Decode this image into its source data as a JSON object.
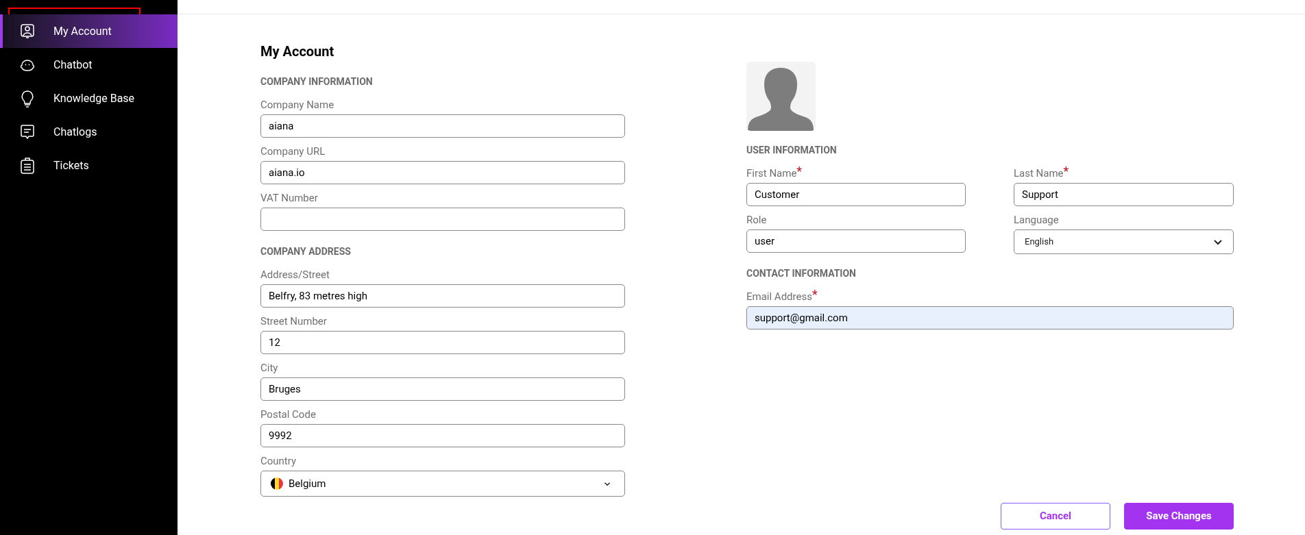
{
  "sidebar": {
    "items": [
      {
        "label": "My Account",
        "selected": true,
        "highlighted": true
      },
      {
        "label": "Chatbot",
        "selected": false,
        "highlighted": false
      },
      {
        "label": "Knowledge Base",
        "selected": false,
        "highlighted": false
      },
      {
        "label": "Chatlogs",
        "selected": false,
        "highlighted": false
      },
      {
        "label": "Tickets",
        "selected": false,
        "highlighted": false
      }
    ]
  },
  "page_title": "My Account",
  "left_sections": [
    {
      "heading": "COMPANY INFORMATION",
      "fields": [
        {
          "kind": "text",
          "label": "Company Name",
          "value": "aiana"
        },
        {
          "kind": "text",
          "label": "Company URL",
          "value": "aiana.io"
        },
        {
          "kind": "text",
          "label": "VAT Number"
        }
      ]
    },
    {
      "heading": "COMPANY ADDRESS",
      "fields": [
        {
          "kind": "text",
          "label": "Address/Street",
          "value": "Belfry, 83 metres high"
        },
        {
          "kind": "text",
          "label": "Street Number",
          "value": "12"
        },
        {
          "kind": "text",
          "label": "City",
          "value": "Bruges"
        },
        {
          "kind": "text",
          "label": "Postal Code",
          "value": "9992"
        },
        {
          "kind": "country",
          "label": "Country",
          "value": "Belgium"
        }
      ]
    }
  ],
  "right_sections": [
    {
      "heading": "USER INFORMATION",
      "fields": [
        {
          "kind": "text",
          "label": "First Name",
          "required_mark": "*",
          "value": "Customer"
        },
        {
          "kind": "text",
          "label": "Last Name",
          "required_mark": "*",
          "value": "Support"
        },
        {
          "kind": "text",
          "label": "Role",
          "value": "user"
        },
        {
          "kind": "select",
          "label": "Language",
          "value": "English"
        }
      ]
    },
    {
      "heading": "CONTACT INFORMATION",
      "fields": [
        {
          "kind": "wide",
          "label": "Email Address",
          "required_mark": "*",
          "value": "support@gmail.com",
          "autofilled": true
        }
      ]
    }
  ],
  "buttons": [
    {
      "label": "Cancel",
      "kind": "secondary"
    },
    {
      "label": "Save Changes",
      "kind": "primary"
    }
  ]
}
